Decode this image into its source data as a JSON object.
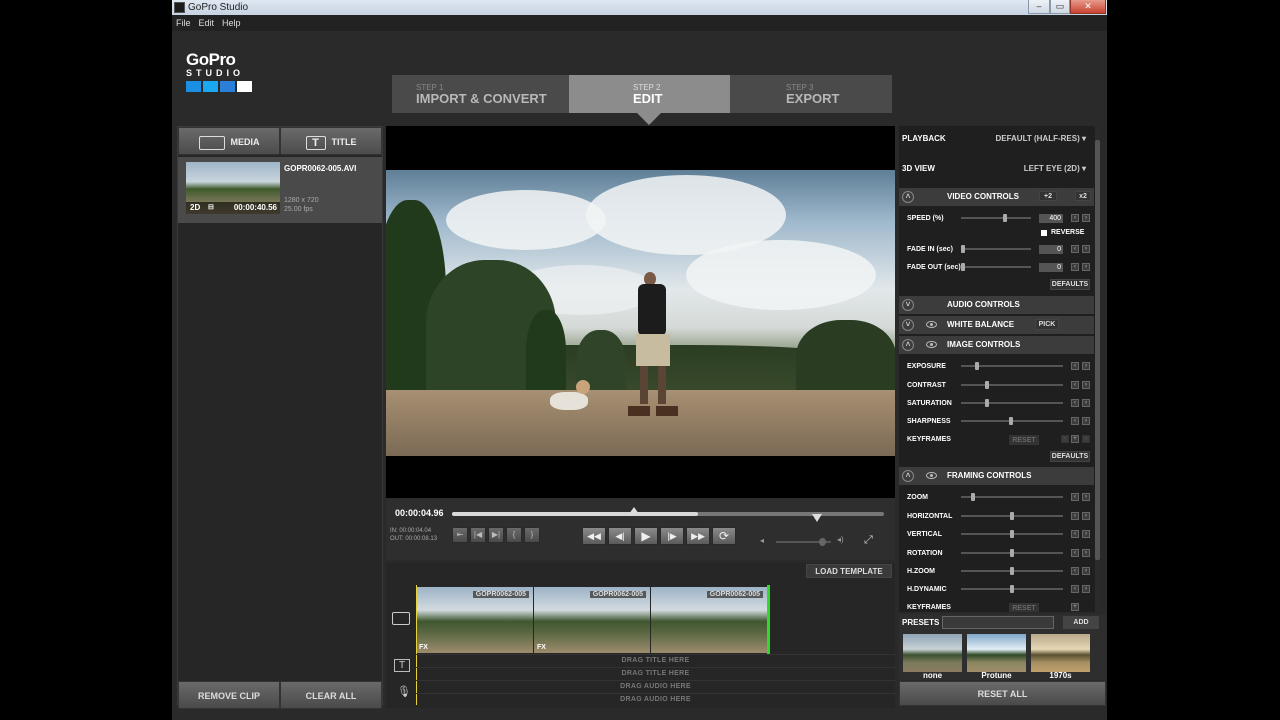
{
  "window": {
    "title": "GoPro Studio",
    "controls": [
      "–",
      "▭",
      "✕"
    ]
  },
  "menu": [
    "File",
    "Edit",
    "Help"
  ],
  "logo": {
    "line1": "GoPro",
    "line2": "STUDIO",
    "colors": [
      "#1a8fe3",
      "#1aa8f0",
      "#2a7fd8",
      "#ffffff"
    ]
  },
  "steps": [
    {
      "num": "STEP 1",
      "label": "IMPORT & CONVERT"
    },
    {
      "num": "STEP 2",
      "label": "EDIT"
    },
    {
      "num": "STEP 3",
      "label": "EXPORT"
    }
  ],
  "left_panel": {
    "tab_media": "MEDIA",
    "tab_title": "TITLE",
    "clip": {
      "name": "GOPR0062-005.AVI",
      "badge": "2D",
      "duration": "00:00:40.56",
      "resolution": "1280 x 720",
      "fps": "25.00 fps"
    },
    "remove_clip": "REMOVE CLIP",
    "clear_all": "CLEAR ALL"
  },
  "transport": {
    "timecode": "00:00:04.96",
    "in_label": "IN:",
    "in_time": "00:00:04.04",
    "out_label": "OUT:",
    "out_time": "00:00:08.13",
    "scrub_progress_fraction": 0.57,
    "volume_fraction": 0.85,
    "buttons": {
      "rewind": "◀◀",
      "step_back": "◀|",
      "play": "▶",
      "step_fwd": "|▶",
      "ffwd": "▶▶",
      "loop": "⟳"
    }
  },
  "right_panel": {
    "playback_label": "PLAYBACK",
    "playback_value": "DEFAULT (HALF-RES)",
    "view3d_label": "3D VIEW",
    "view3d_value": "LEFT EYE (2D)",
    "video_controls": "VIDEO CONTROLS",
    "x2_plus": "+2",
    "x2": "x2",
    "speed_label": "SPEED (%)",
    "speed_value": "400",
    "reverse": "REVERSE",
    "fade_in_label": "FADE IN (sec)",
    "fade_in_value": "0",
    "fade_out_label": "FADE OUT (sec)",
    "fade_out_value": "0",
    "defaults": "DEFAULTS",
    "audio_controls": "AUDIO CONTROLS",
    "white_balance": "WHITE BALANCE",
    "pick": "PICK",
    "image_controls": "IMAGE CONTROLS",
    "exposure": "EXPOSURE",
    "contrast": "CONTRAST",
    "saturation": "SATURATION",
    "sharpness": "SHARPNESS",
    "keyframes": "KEYFRAMES",
    "reset": "RESET",
    "defaults2": "DEFAULTS",
    "framing_controls": "FRAMING CONTROLS",
    "zoom": "ZOOM",
    "horizontal": "HORIZONTAL",
    "vertical": "VERTICAL",
    "rotation": "ROTATION",
    "hzoom": "H.ZOOM",
    "hdynamic": "H.DYNAMIC",
    "keyframes2": "KEYFRAMES",
    "reset2": "RESET"
  },
  "presets": {
    "label": "PRESETS",
    "add": "ADD",
    "items": [
      "none",
      "Protune",
      "1970s"
    ],
    "reset_all": "RESET ALL"
  },
  "timeline": {
    "load_template": "LOAD TEMPLATE",
    "clip_name": "GOPR0062-005",
    "fx": "FX",
    "drag_title_1": "DRAG TITLE HERE",
    "drag_title_2": "DRAG TITLE HERE",
    "drag_audio_1": "DRAG AUDIO HERE",
    "drag_audio_2": "DRAG AUDIO HERE"
  }
}
